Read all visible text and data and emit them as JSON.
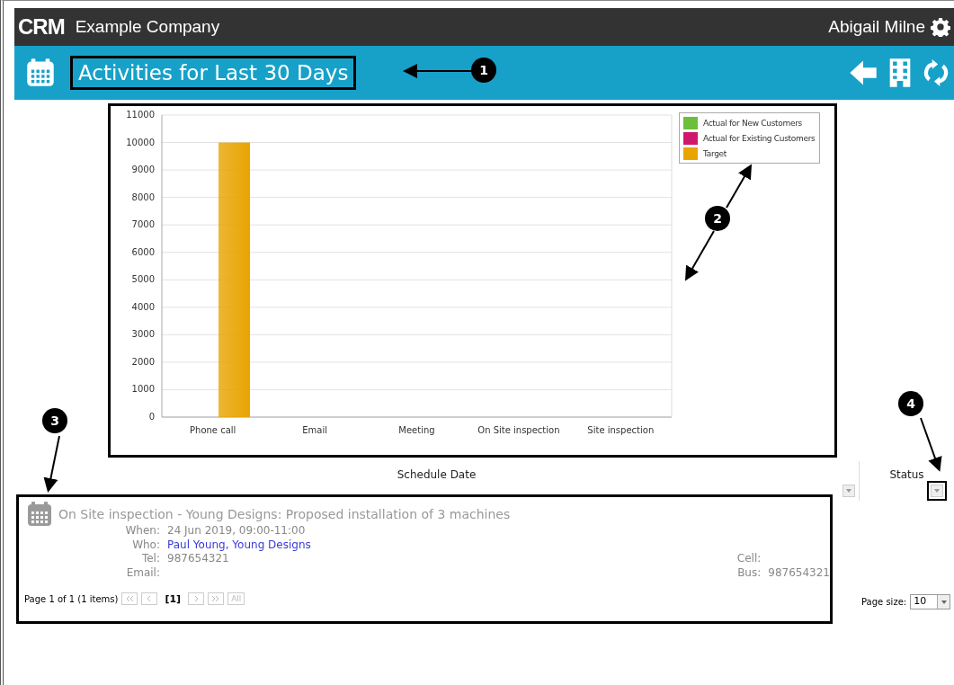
{
  "top_bar": {
    "logo": "CRM",
    "company": "Example Company",
    "user": "Abigail Milne"
  },
  "header": {
    "title": "Activities for Last 30 Days"
  },
  "chart": {
    "chart_data": {
      "type": "bar",
      "categories": [
        "Phone call",
        "Email",
        "Meeting",
        "On Site inspection",
        "Site inspection"
      ],
      "series": [
        {
          "name": "Actual for New Customers",
          "color": "#6cbf3a",
          "values": [
            0,
            0,
            0,
            0,
            0
          ]
        },
        {
          "name": "Actual for Existing Customers",
          "color": "#d0176e",
          "values": [
            0,
            0,
            0,
            0,
            0
          ]
        },
        {
          "name": "Target",
          "color": "#e8a400",
          "values": [
            10000,
            0,
            0,
            0,
            0
          ]
        }
      ],
      "ylim": [
        0,
        11000
      ],
      "grid": true,
      "yticks": [
        0,
        1000,
        2000,
        3000,
        4000,
        5000,
        6000,
        7000,
        8000,
        9000,
        10000,
        11000
      ]
    }
  },
  "grid": {
    "columns": [
      {
        "label": "Schedule Date"
      },
      {
        "label": "Status"
      }
    ],
    "record": {
      "title": "On Site inspection - Young Designs: Proposed installation of 3 machines",
      "left_fields": [
        {
          "label": "When:",
          "value": "24 Jun 2019, 09:00-11:00",
          "kind": "text"
        },
        {
          "label": "Who:",
          "value": "Paul Young, Young Designs",
          "kind": "link"
        },
        {
          "label": "Tel:",
          "value": "987654321",
          "kind": "text"
        },
        {
          "label": "Email:",
          "kind": "text"
        }
      ],
      "right_fields": [
        {
          "label": "Cell:"
        },
        {
          "label": "Bus:",
          "value": "987654321"
        }
      ]
    },
    "pager": {
      "summary": "Page 1 of 1 (1 items)",
      "current": "[1]",
      "all": "All",
      "page_size_label": "Page size:",
      "page_size": "10"
    }
  },
  "callouts": [
    "1",
    "2",
    "3",
    "4"
  ]
}
